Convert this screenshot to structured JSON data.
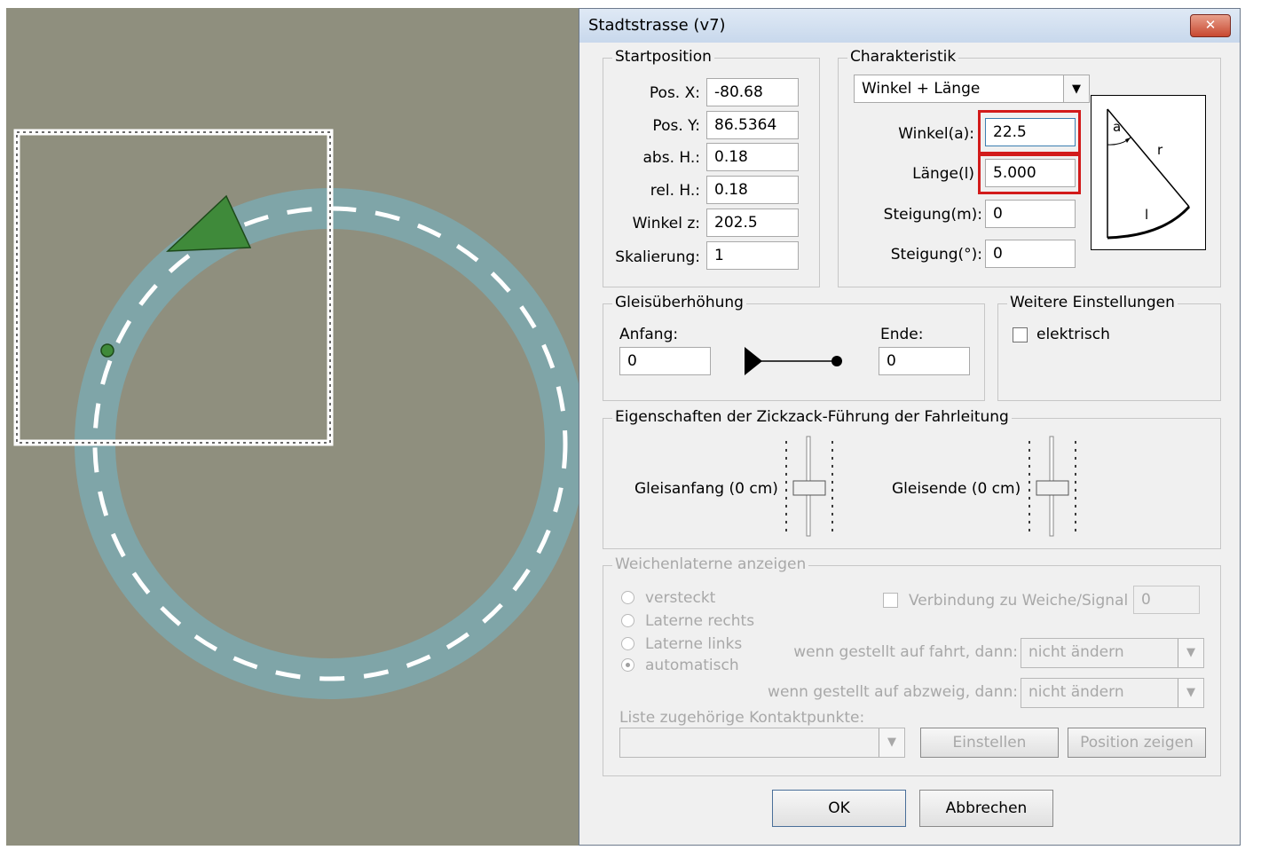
{
  "dialog": {
    "title": "Stadtstrasse (v7)",
    "close_icon": "close-icon"
  },
  "startposition": {
    "legend": "Startposition",
    "fields": [
      {
        "label": "Pos. X:",
        "value": "-80.68"
      },
      {
        "label": "Pos. Y:",
        "value": "86.5364"
      },
      {
        "label": "abs. H.:",
        "value": "0.18"
      },
      {
        "label": "rel. H.:",
        "value": "0.18"
      },
      {
        "label": "Winkel z:",
        "value": "202.5"
      },
      {
        "label": "Skalierung:",
        "value": "1"
      }
    ]
  },
  "charakteristik": {
    "legend": "Charakteristik",
    "mode": "Winkel + Länge",
    "winkel_label": "Winkel(a):",
    "winkel_value": "22.5",
    "laenge_label": "Länge(l)",
    "laenge_value": "5.000",
    "steigung_m_label": "Steigung(m):",
    "steigung_m_value": "0",
    "steigung_deg_label": "Steigung(°):",
    "steigung_deg_value": "0",
    "diagram_a": "a",
    "diagram_r": "r",
    "diagram_l": "l",
    "highlight_color": "#d21b1b"
  },
  "gleisueberhoehung": {
    "legend": "Gleisüberhöhung",
    "anfang_label": "Anfang:",
    "anfang_value": "0",
    "ende_label": "Ende:",
    "ende_value": "0"
  },
  "weitere": {
    "legend": "Weitere Einstellungen",
    "elektrisch_label": "elektrisch",
    "elektrisch_checked": false
  },
  "zickzack": {
    "legend": "Eigenschaften der Zickzack-Führung der Fahrleitung",
    "gleisanfang_label": "Gleisanfang (0 cm)",
    "gleisende_label": "Gleisende (0 cm)"
  },
  "weichenlaterne": {
    "legend": "Weichenlaterne anzeigen",
    "radios": [
      "versteckt",
      "Laterne rechts",
      "Laterne links",
      "automatisch"
    ],
    "selected": "automatisch",
    "verbindung_label": "Verbindung zu Weiche/Signal",
    "verbindung_value": "0",
    "fahrt_label": "wenn gestellt auf fahrt, dann:",
    "fahrt_value": "nicht ändern",
    "abzweig_label": "wenn gestellt auf abzweig, dann:",
    "abzweig_value": "nicht ändern",
    "liste_label": "Liste zugehörige Kontaktpunkte:",
    "liste_value": "",
    "einstellen_label": "Einstellen",
    "position_label": "Position zeigen"
  },
  "buttons": {
    "ok": "OK",
    "abbrechen": "Abbrechen"
  },
  "viewport": {
    "background": "#8f8f7e",
    "track_color": "#7fa5a8",
    "marker_color": "#3f8a3a"
  }
}
